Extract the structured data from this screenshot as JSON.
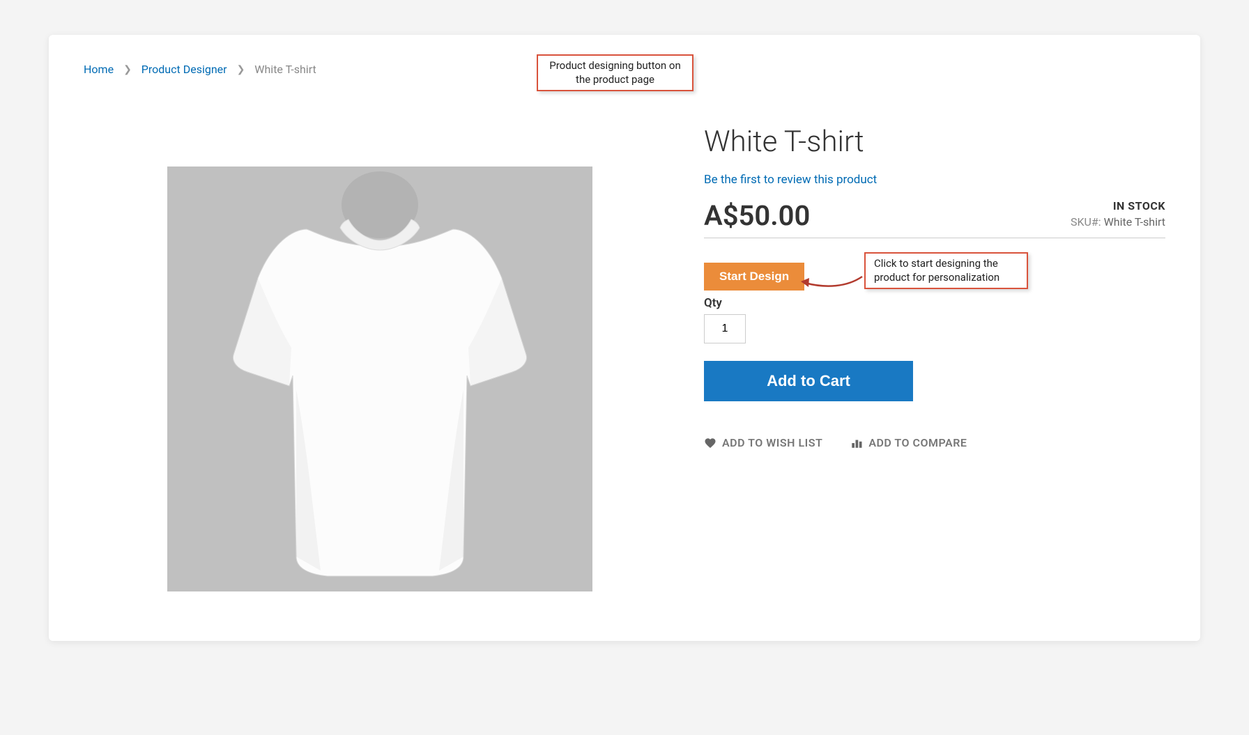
{
  "breadcrumb": {
    "home": "Home",
    "category": "Product Designer",
    "current": "White T-shirt"
  },
  "product": {
    "title": "White T-shirt",
    "review_link": "Be the first to review this product",
    "price": "A$50.00",
    "stock_status": "IN STOCK",
    "sku_label": "SKU#:",
    "sku_value": "White T-shirt"
  },
  "actions": {
    "start_design": "Start Design",
    "qty_label": "Qty",
    "qty_value": "1",
    "add_to_cart": "Add to Cart",
    "wishlist": "ADD TO WISH LIST",
    "compare": "ADD TO COMPARE"
  },
  "callouts": {
    "top": "Product designing button on the product page",
    "design": "Click to start designing the product for personalization"
  }
}
